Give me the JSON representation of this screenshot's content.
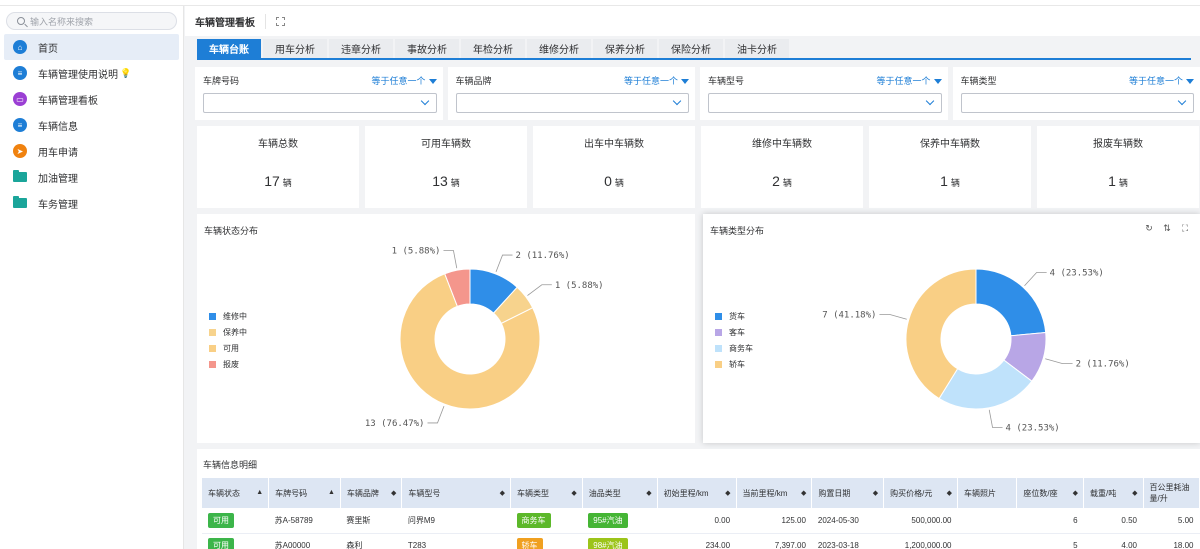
{
  "sidebar": {
    "search_placeholder": "输入名称来搜索",
    "items": [
      {
        "label": "首页",
        "icon": "home-icon",
        "color": "#1e7ed6"
      },
      {
        "label": "车辆管理使用说明",
        "icon": "doc-icon",
        "color": "#1e7ed6"
      },
      {
        "label": "车辆管理看板",
        "icon": "dashboard-icon",
        "color": "#9b3fd4"
      },
      {
        "label": "车辆信息",
        "icon": "doc-icon",
        "color": "#1e7ed6"
      },
      {
        "label": "用车申请",
        "icon": "send-icon",
        "color": "#f0820f"
      },
      {
        "label": "加油管理",
        "icon": "folder-icon",
        "color": "#1aa59a"
      },
      {
        "label": "车务管理",
        "icon": "folder-icon",
        "color": "#1aa59a"
      }
    ]
  },
  "header": {
    "title": "车辆管理看板"
  },
  "tabs": [
    "车辆台账",
    "用车分析",
    "违章分析",
    "事故分析",
    "年检分析",
    "维修分析",
    "保养分析",
    "保险分析",
    "油卡分析"
  ],
  "filters": [
    {
      "label": "车牌号码",
      "op": "等于任意一个"
    },
    {
      "label": "车辆品牌",
      "op": "等于任意一个"
    },
    {
      "label": "车辆型号",
      "op": "等于任意一个"
    },
    {
      "label": "车辆类型",
      "op": "等于任意一个"
    }
  ],
  "kpis": [
    {
      "label": "车辆总数",
      "value": "17",
      "unit": "辆"
    },
    {
      "label": "可用车辆数",
      "value": "13",
      "unit": "辆"
    },
    {
      "label": "出车中车辆数",
      "value": "0",
      "unit": "辆"
    },
    {
      "label": "维修中车辆数",
      "value": "2",
      "unit": "辆"
    },
    {
      "label": "保养中车辆数",
      "value": "1",
      "unit": "辆"
    },
    {
      "label": "报废车辆数",
      "value": "1",
      "unit": "辆"
    }
  ],
  "chart_data": [
    {
      "type": "pie",
      "title": "车辆状态分布",
      "legend": "left",
      "categories": [
        "维修中",
        "保养中",
        "可用",
        "报废"
      ],
      "values": [
        2,
        1,
        13,
        1
      ],
      "labels": [
        "2 (11.76%)",
        "1 (5.88%)",
        "13 (76.47%)",
        "1 (5.88%)"
      ],
      "colors": [
        "#2f8ee8",
        "#f7d38d",
        "#f9cf85",
        "#f4968c"
      ]
    },
    {
      "type": "pie",
      "title": "车辆类型分布",
      "legend": "left",
      "categories": [
        "货车",
        "客车",
        "商务车",
        "轿车"
      ],
      "values": [
        4,
        2,
        4,
        7
      ],
      "labels": [
        "4 (23.53%)",
        "2 (11.76%)",
        "4 (23.53%)",
        "7 (41.18%)"
      ],
      "colors": [
        "#2f8ee8",
        "#b8a6e6",
        "#bfe2fb",
        "#f9cf85"
      ]
    }
  ],
  "table": {
    "title": "车辆信息明细",
    "columns": [
      "车辆状态",
      "车牌号码",
      "车辆品牌",
      "车辆型号",
      "车辆类型",
      "油品类型",
      "初始里程/km",
      "当前里程/km",
      "购置日期",
      "购买价格/元",
      "车辆照片",
      "座位数/座",
      "载重/吨",
      "百公里耗油量/升"
    ],
    "rows": [
      [
        "可用",
        "苏A-58789",
        "赛里斯",
        "问界M9",
        "商务车",
        "95#汽油",
        "0.00",
        "125.00",
        "2024-05-30",
        "500,000.00",
        "",
        "6",
        "0.50",
        "5.00"
      ],
      [
        "可用",
        "苏A00000",
        "森利",
        "T283",
        "轿车",
        "98#汽油",
        "234.00",
        "7,397.00",
        "2023-03-18",
        "1,200,000.00",
        "",
        "5",
        "4.00",
        "18.00"
      ]
    ]
  }
}
